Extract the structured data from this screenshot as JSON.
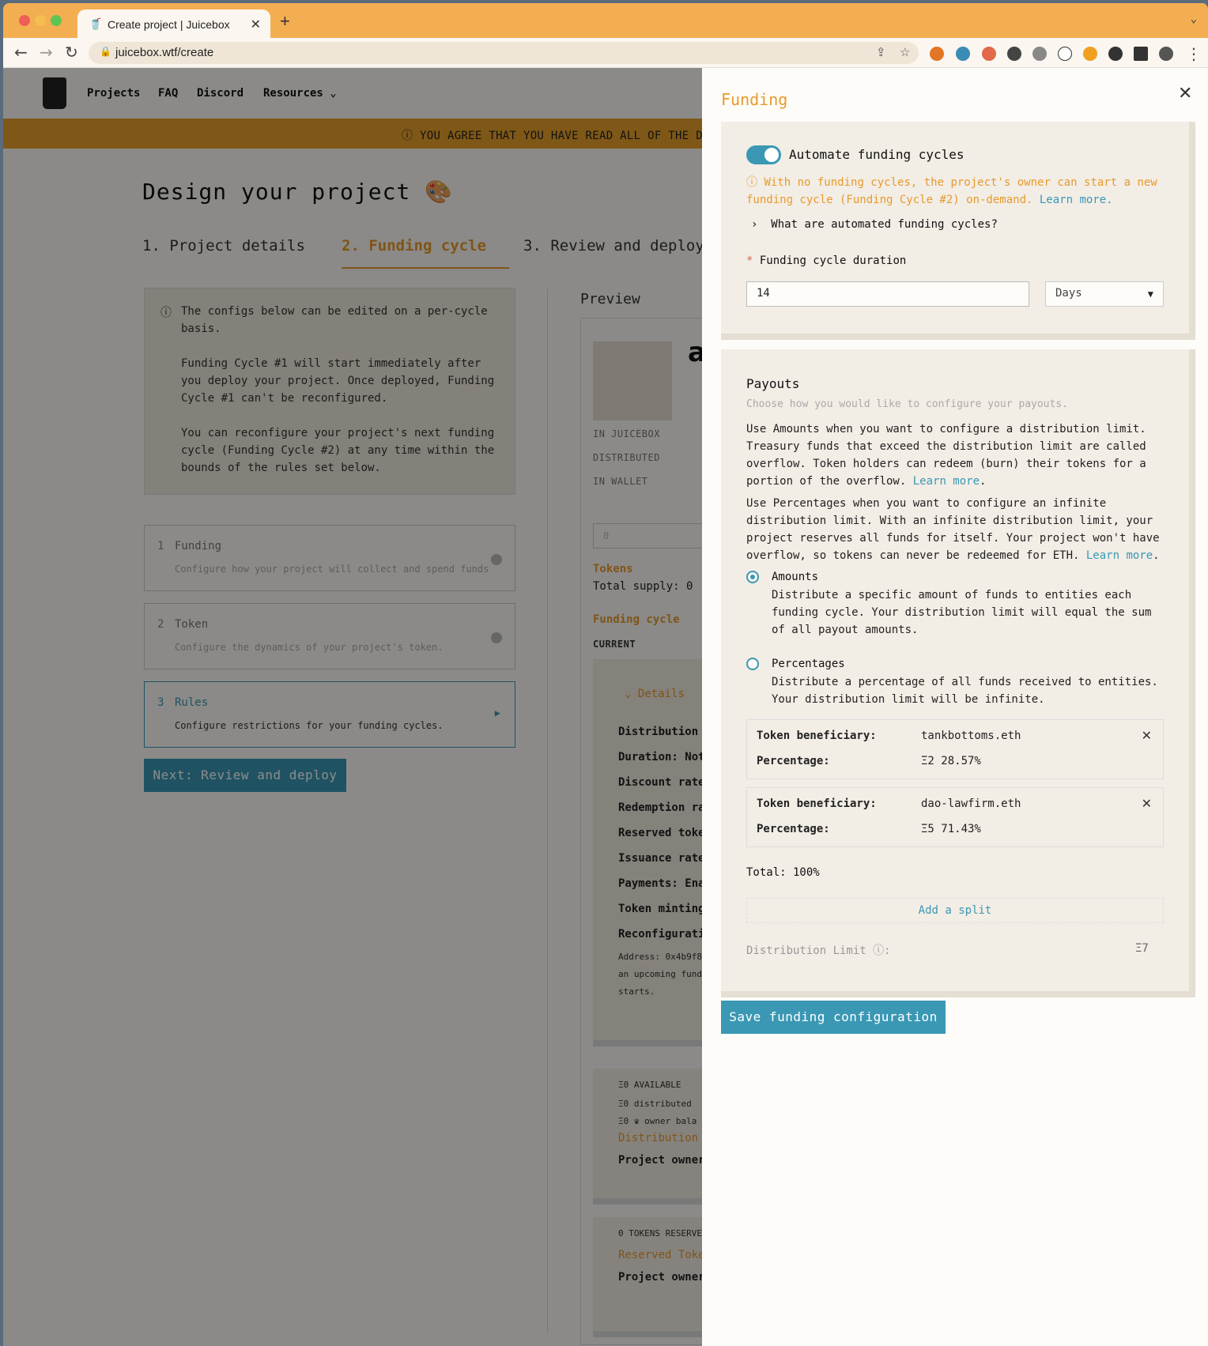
{
  "browser": {
    "tab_title": "Create project | Juicebox",
    "url": "juicebox.wtf/create"
  },
  "nav": {
    "links": [
      "Projects",
      "FAQ",
      "Discord",
      "Resources"
    ]
  },
  "banner": {
    "text": "YOU AGREE THAT YOU HAVE READ ALL OF THE DA"
  },
  "page": {
    "title": "Design your project 🎨",
    "steps": [
      "1. Project details",
      "2. Funding cycle",
      "3. Review and deploy"
    ]
  },
  "info": {
    "p1": "The configs below can be edited on a per-cycle basis.",
    "p2": "Funding Cycle #1 will start immediately after you deploy your project. Once deployed, Funding Cycle #1 can't be reconfigured.",
    "p3": "You can reconfigure your project's next funding cycle (Funding Cycle #2) at any time within the bounds of the rules set below."
  },
  "sections": [
    {
      "num": "1",
      "title": "Funding",
      "desc": "Configure how your project will collect and spend funds"
    },
    {
      "num": "2",
      "title": "Token",
      "desc": "Configure the dynamics of your project's token."
    },
    {
      "num": "3",
      "title": "Rules",
      "desc": "Configure restrictions for your funding cycles."
    }
  ],
  "next_button": "Next: Review and deploy",
  "preview": {
    "label": "Preview",
    "name": "a",
    "stats": [
      "IN JUICEBOX",
      "DISTRIBUTED",
      "IN WALLET"
    ],
    "input_placeholder": "0",
    "tokens": "Tokens",
    "total_supply": "Total supply:  0",
    "funding_cycle": "Funding cycle",
    "current": "CURRENT",
    "details": "Details",
    "rows": [
      "Distribution",
      "Duration: Not",
      "Discount rate",
      "Redemption ra",
      "Reserved toke",
      "Issuance rate",
      "Payments: Ena",
      "Token minting",
      "Reconfigurati"
    ],
    "note1": "Address: 0x4b9f8",
    "note2": "an upcoming fund",
    "note3": "starts.",
    "avail": "Ξ0 AVAILABLE",
    "distributed": "Ξ0 distributed",
    "owner_bal": "Ξ0 ♛ owner bala",
    "distribution": "Distribution",
    "project_owner": "Project owner",
    "tokens_reserved": "0 TOKENS RESERVE",
    "reserved_tokens": "Reserved Toke",
    "project_owner2": "Project owner"
  },
  "drawer": {
    "title": "Funding",
    "automate_label": "Automate funding cycles",
    "automate_warning": "With no funding cycles, the project's owner can start a new funding cycle (Funding Cycle #2) on-demand.",
    "learn_more": "Learn more.",
    "what_are": "What are automated funding cycles?",
    "duration_label": "Funding cycle duration",
    "duration_value": "14",
    "duration_unit": "Days",
    "payouts_title": "Payouts",
    "payouts_sub": "Choose how you would like to configure your payouts.",
    "amounts_p": "Use Amounts when you want to configure a distribution limit. Treasury funds that exceed the distribution limit are called overflow. Token holders can redeem (burn) their tokens for a portion of the overflow.",
    "percent_p": "Use Percentages when you want to configure an infinite distribution limit. With an infinite distribution limit, your project reserves all funds for itself. Your project won't have overflow, so tokens can never be redeemed for ETH.",
    "learn_more2": "Learn more",
    "option_amounts": "Amounts",
    "option_amounts_desc": "Distribute a specific amount of funds to entities each funding cycle. Your distribution limit will equal the sum of all payout amounts.",
    "option_percent": "Percentages",
    "option_percent_desc": "Distribute a percentage of all funds received to entities. Your distribution limit will be infinite.",
    "splits": [
      {
        "ben_label": "Token beneficiary:",
        "ben": "tankbottoms.eth",
        "pct_label": "Percentage:",
        "pct": "Ξ2  28.57%"
      },
      {
        "ben_label": "Token beneficiary:",
        "ben": "dao-lawfirm.eth",
        "pct_label": "Percentage:",
        "pct": "Ξ5  71.43%"
      }
    ],
    "total": "Total: 100%",
    "add_split": "Add a split",
    "dist_limit_label": "Distribution Limit ⓘ:",
    "dist_limit_value": "Ξ7",
    "save_button": "Save funding configuration"
  },
  "colors": {
    "accent": "#3a98b4",
    "orange": "#e89a2c",
    "tabbar": "#f4ae52"
  }
}
